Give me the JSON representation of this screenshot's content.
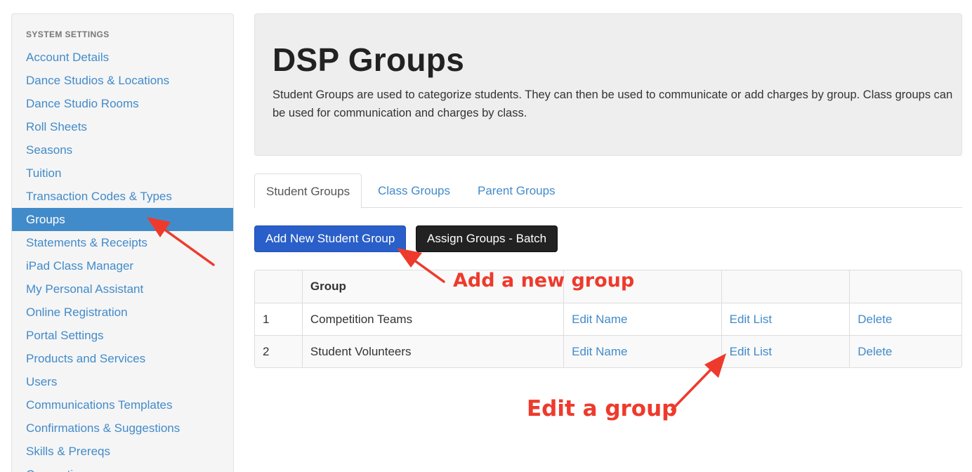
{
  "sidebar": {
    "header": "SYSTEM SETTINGS",
    "items": [
      {
        "label": "Account Details"
      },
      {
        "label": "Dance Studios & Locations"
      },
      {
        "label": "Dance Studio Rooms"
      },
      {
        "label": "Roll Sheets"
      },
      {
        "label": "Seasons"
      },
      {
        "label": "Tuition"
      },
      {
        "label": "Transaction Codes & Types"
      },
      {
        "label": "Groups",
        "active": true
      },
      {
        "label": "Statements & Receipts"
      },
      {
        "label": "iPad Class Manager"
      },
      {
        "label": "My Personal Assistant"
      },
      {
        "label": "Online Registration"
      },
      {
        "label": "Portal Settings"
      },
      {
        "label": "Products and Services"
      },
      {
        "label": "Users"
      },
      {
        "label": "Communications Templates"
      },
      {
        "label": "Confirmations & Suggestions"
      },
      {
        "label": "Skills & Prereqs"
      },
      {
        "label": "Connections"
      }
    ]
  },
  "page": {
    "title": "DSP Groups",
    "description": "Student Groups are used to categorize students. They can then be used to communicate or add charges by group. Class groups can be used for communication and charges by class."
  },
  "tabs": [
    {
      "label": "Student Groups",
      "active": true
    },
    {
      "label": "Class Groups"
    },
    {
      "label": "Parent Groups"
    }
  ],
  "toolbar": {
    "add_label": "Add New Student Group",
    "batch_label": "Assign Groups - Batch"
  },
  "table": {
    "headers": [
      "",
      "Group",
      "",
      "",
      ""
    ],
    "rows": [
      {
        "num": "1",
        "group": "Competition Teams",
        "edit_name": "Edit Name",
        "edit_list": "Edit List",
        "delete": "Delete"
      },
      {
        "num": "2",
        "group": "Student Volunteers",
        "edit_name": "Edit Name",
        "edit_list": "Edit List",
        "delete": "Delete"
      }
    ]
  },
  "annotations": {
    "add_note": "Add a new group",
    "edit_note": "Edit a group",
    "color": "#ee3a2c"
  },
  "colors": {
    "link": "#428bca",
    "active": "#428bca",
    "primary_button": "#2a5fc9",
    "dark_button": "#222222"
  }
}
